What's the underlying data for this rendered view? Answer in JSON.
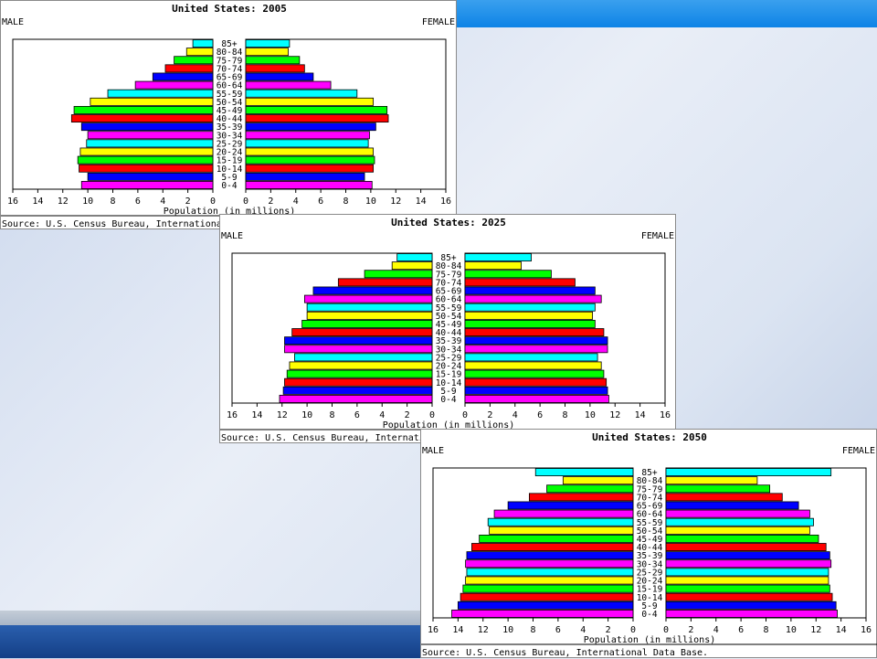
{
  "chart_data": [
    {
      "type": "bar",
      "title": "United States: 2005",
      "left_label": "MALE",
      "right_label": "FEMALE",
      "xlabel": "Population (in millions)",
      "source": "Source: U.S. Census Bureau, International Data Base.",
      "xlim": [
        0,
        16
      ],
      "ticks": [
        "16",
        "14",
        "12",
        "10",
        "8",
        "6",
        "4",
        "2",
        "0"
      ],
      "ticks_right": [
        "0",
        "2",
        "4",
        "6",
        "8",
        "10",
        "12",
        "14",
        "16"
      ],
      "categories": [
        "85+",
        "80-84",
        "75-79",
        "70-74",
        "65-69",
        "60-64",
        "55-59",
        "50-54",
        "45-49",
        "40-44",
        "35-39",
        "30-34",
        "25-29",
        "20-24",
        "15-19",
        "10-14",
        "5-9",
        "0-4"
      ],
      "series": [
        {
          "name": "MALE",
          "values": [
            1.6,
            2.1,
            3.1,
            3.8,
            4.8,
            6.2,
            8.4,
            9.8,
            11.1,
            11.3,
            10.5,
            10.0,
            10.1,
            10.6,
            10.8,
            10.7,
            10.0,
            10.5
          ]
        },
        {
          "name": "FEMALE",
          "values": [
            3.5,
            3.4,
            4.3,
            4.7,
            5.4,
            6.8,
            8.9,
            10.2,
            11.3,
            11.4,
            10.4,
            9.9,
            9.8,
            10.2,
            10.3,
            10.2,
            9.5,
            10.1
          ]
        }
      ]
    },
    {
      "type": "bar",
      "title": "United States: 2025",
      "left_label": "MALE",
      "right_label": "FEMALE",
      "xlabel": "Population (in millions)",
      "source": "Source: U.S. Census Bureau, International Data Base.",
      "xlim": [
        0,
        16
      ],
      "ticks": [
        "16",
        "14",
        "12",
        "10",
        "8",
        "6",
        "4",
        "2",
        "0"
      ],
      "ticks_right": [
        "0",
        "2",
        "4",
        "6",
        "8",
        "10",
        "12",
        "14",
        "16"
      ],
      "categories": [
        "85+",
        "80-84",
        "75-79",
        "70-74",
        "65-69",
        "60-64",
        "55-59",
        "50-54",
        "45-49",
        "40-44",
        "35-39",
        "30-34",
        "25-29",
        "20-24",
        "15-19",
        "10-14",
        "5-9",
        "0-4"
      ],
      "series": [
        {
          "name": "MALE",
          "values": [
            2.8,
            3.2,
            5.4,
            7.5,
            9.5,
            10.2,
            10.0,
            10.0,
            10.4,
            11.2,
            11.8,
            11.8,
            11.0,
            11.4,
            11.6,
            11.8,
            11.9,
            12.2
          ]
        },
        {
          "name": "FEMALE",
          "values": [
            5.3,
            4.5,
            6.9,
            8.8,
            10.4,
            10.9,
            10.4,
            10.2,
            10.4,
            11.1,
            11.4,
            11.4,
            10.6,
            10.9,
            11.1,
            11.3,
            11.4,
            11.5
          ]
        }
      ]
    },
    {
      "type": "bar",
      "title": "United States: 2050",
      "left_label": "MALE",
      "right_label": "FEMALE",
      "xlabel": "Population (in millions)",
      "source": "Source: U.S. Census Bureau, International Data Base.",
      "xlim": [
        0,
        16
      ],
      "ticks": [
        "16",
        "14",
        "12",
        "10",
        "8",
        "6",
        "4",
        "2",
        "0"
      ],
      "ticks_right": [
        "0",
        "2",
        "4",
        "6",
        "8",
        "10",
        "12",
        "14",
        "16"
      ],
      "categories": [
        "85+",
        "80-84",
        "75-79",
        "70-74",
        "65-69",
        "60-64",
        "55-59",
        "50-54",
        "45-49",
        "40-44",
        "35-39",
        "30-34",
        "25-29",
        "20-24",
        "15-19",
        "10-14",
        "5-9",
        "0-4"
      ],
      "series": [
        {
          "name": "MALE",
          "values": [
            7.8,
            5.6,
            6.9,
            8.3,
            10.0,
            11.1,
            11.6,
            11.5,
            12.3,
            12.9,
            13.3,
            13.4,
            13.3,
            13.4,
            13.6,
            13.8,
            14.0,
            14.5
          ]
        },
        {
          "name": "FEMALE",
          "values": [
            13.2,
            7.3,
            8.3,
            9.3,
            10.6,
            11.5,
            11.8,
            11.5,
            12.2,
            12.8,
            13.1,
            13.2,
            13.0,
            13.0,
            13.1,
            13.3,
            13.6,
            13.7
          ]
        }
      ]
    }
  ],
  "bar_colors": [
    "#ff00ff",
    "#0000ff",
    "#ff0000",
    "#00ff00",
    "#ffff00",
    "#00ffff"
  ]
}
